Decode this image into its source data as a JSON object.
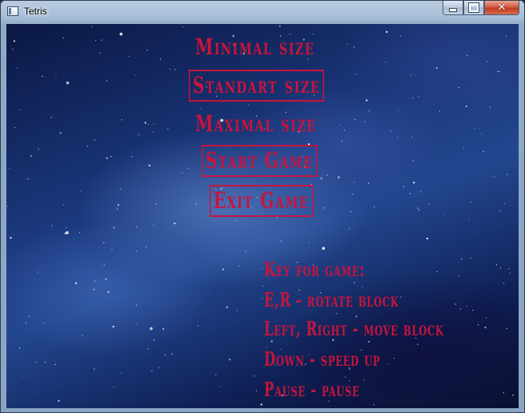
{
  "window": {
    "title": "Tetris",
    "controls": {
      "minimize": "minimize",
      "maximize": "maximize",
      "close": "✕"
    }
  },
  "menu": {
    "minimal_size": "Minimal size",
    "standart_size": "Standart size",
    "maximal_size": "Maximal size",
    "start_game": "Start Game",
    "exit_game": "Exit Game"
  },
  "help": {
    "heading": "Key for game:",
    "rotate": "E,R - rotate block",
    "move": "Left, Right - move block",
    "speed": "Down - speed up",
    "pause": "Pause - pause"
  },
  "colors": {
    "text": "#c8143c",
    "background": "#1c3a80"
  }
}
